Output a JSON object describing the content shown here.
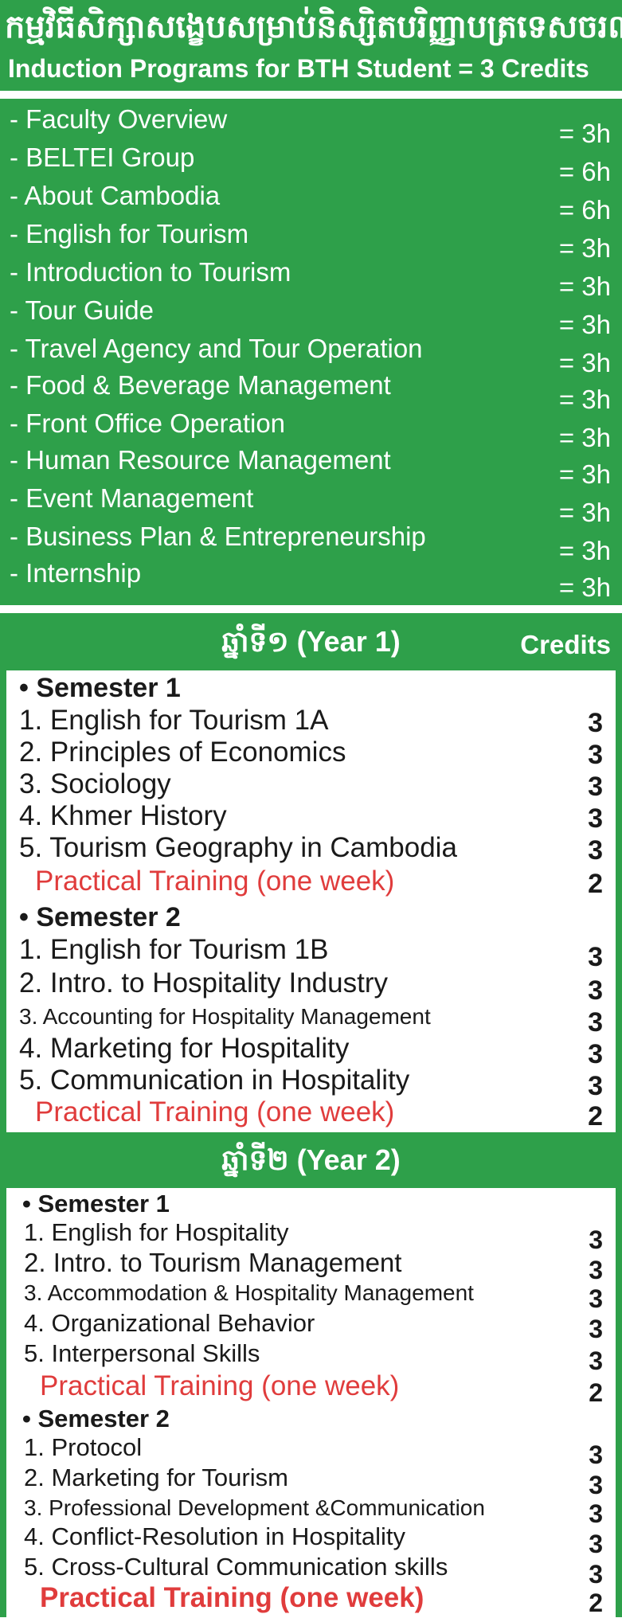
{
  "header": {
    "khmer_title": "កម្មវិធីសិក្សាសង្ខេបសម្រាប់និស្សិតបរិញ្ញាបត្រទេសចរណ៍ និងបដិសណ្ឋារកិច្ច",
    "english_title": "Induction Programs for BTH Student = 3 Credits"
  },
  "induction": [
    {
      "label": "- Faculty Overview",
      "hours": "= 3h"
    },
    {
      "label": "- BELTEI Group",
      "hours": "= 6h"
    },
    {
      "label": "- About Cambodia",
      "hours": "= 6h"
    },
    {
      "label": "- English for Tourism",
      "hours": "= 3h"
    },
    {
      "label": "- Introduction to Tourism",
      "hours": "= 3h"
    },
    {
      "label": "- Tour Guide",
      "hours": "= 3h"
    },
    {
      "label": "- Travel Agency and Tour Operation",
      "hours": "= 3h"
    },
    {
      "label": "- Food & Beverage Management",
      "hours": "= 3h"
    },
    {
      "label": "- Front Office Operation",
      "hours": "= 3h"
    },
    {
      "label": "- Human Resource Management",
      "hours": "= 3h"
    },
    {
      "label": "- Event Management",
      "hours": "= 3h"
    },
    {
      "label": "- Business Plan & Entrepreneurship",
      "hours": "= 3h"
    },
    {
      "label": "- Internship",
      "hours": "= 3h"
    }
  ],
  "year1": {
    "title": "ឆ្នាំទី១ (Year 1)",
    "credits_heading": "Credits",
    "sem1": {
      "heading": "• Semester 1",
      "courses": [
        {
          "name": "1. English for Tourism 1A",
          "credits": "3"
        },
        {
          "name": "2. Principles of Economics",
          "credits": "3"
        },
        {
          "name": "3. Sociology",
          "credits": "3"
        },
        {
          "name": "4. Khmer History",
          "credits": "3"
        },
        {
          "name": "5. Tourism Geography in Cambodia",
          "credits": "3"
        }
      ],
      "practical": {
        "name": "Practical Training (one week)",
        "credits": "2"
      }
    },
    "sem2": {
      "heading": "• Semester 2",
      "courses": [
        {
          "name": "1. English for Tourism 1B",
          "credits": "3"
        },
        {
          "name": "2. Intro. to Hospitality Industry",
          "credits": "3"
        },
        {
          "name": "3. Accounting for Hospitality Management",
          "credits": "3"
        },
        {
          "name": "4. Marketing for Hospitality",
          "credits": "3"
        },
        {
          "name": "5. Communication in Hospitality",
          "credits": "3"
        }
      ],
      "practical": {
        "name": "Practical Training (one week)",
        "credits": "2"
      }
    }
  },
  "year2": {
    "title": "ឆ្នាំទី២ (Year 2)",
    "sem1": {
      "heading": "• Semester 1",
      "courses": [
        {
          "name": "1. English for Hospitality",
          "credits": "3"
        },
        {
          "name": "2. Intro. to Tourism Management",
          "credits": "3"
        },
        {
          "name": "3. Accommodation & Hospitality Management",
          "credits": "3"
        },
        {
          "name": "4. Organizational Behavior",
          "credits": "3"
        },
        {
          "name": "5. Interpersonal Skills",
          "credits": "3"
        }
      ],
      "practical": {
        "name": "Practical Training (one week)",
        "credits": "2"
      }
    },
    "sem2": {
      "heading": "• Semester 2",
      "courses": [
        {
          "name": "1. Protocol",
          "credits": "3"
        },
        {
          "name": "2. Marketing for Tourism",
          "credits": "3"
        },
        {
          "name": "3. Professional Development &Communication",
          "credits": "3"
        },
        {
          "name": "4. Conflict-Resolution in Hospitality",
          "credits": "3"
        },
        {
          "name": "5. Cross-Cultural Communication skills",
          "credits": "3"
        }
      ],
      "practical": {
        "name": "Practical Training (one week)",
        "credits": "2"
      }
    }
  }
}
